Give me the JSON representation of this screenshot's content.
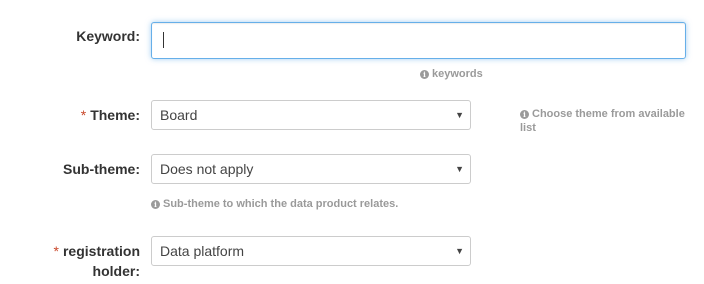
{
  "fields": {
    "keyword": {
      "label": "Keyword:",
      "value": "",
      "help": "keywords"
    },
    "theme": {
      "required_mark": "*",
      "label": "Theme:",
      "selected": "Board",
      "help": "Choose theme from available list"
    },
    "subtheme": {
      "label": "Sub-theme:",
      "selected": "Does not apply",
      "help": "Sub-theme to which the data product relates."
    },
    "registration_holder": {
      "required_mark": "*",
      "label_line1": "registration",
      "label_line2": "holder:",
      "selected": "Data platform"
    }
  },
  "icons": {
    "info": "info-icon",
    "dropdown": "caret-down-icon"
  },
  "colors": {
    "required": "#c9472a",
    "focus_border": "#66afe9",
    "help_text": "#9a9a9a"
  }
}
